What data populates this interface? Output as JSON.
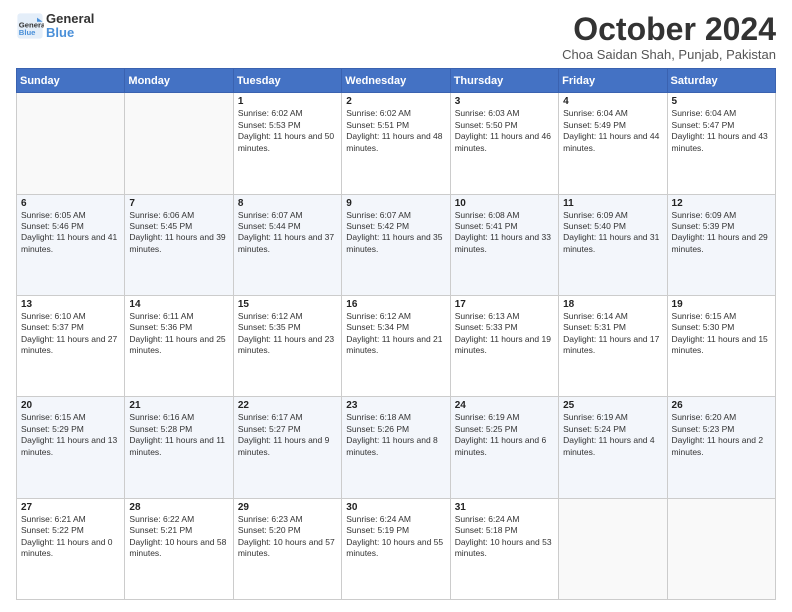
{
  "header": {
    "logo_line1": "General",
    "logo_line2": "Blue",
    "month": "October 2024",
    "location": "Choa Saidan Shah, Punjab, Pakistan"
  },
  "days_of_week": [
    "Sunday",
    "Monday",
    "Tuesday",
    "Wednesday",
    "Thursday",
    "Friday",
    "Saturday"
  ],
  "weeks": [
    [
      {
        "day": "",
        "sunrise": "",
        "sunset": "",
        "daylight": ""
      },
      {
        "day": "",
        "sunrise": "",
        "sunset": "",
        "daylight": ""
      },
      {
        "day": "1",
        "sunrise": "Sunrise: 6:02 AM",
        "sunset": "Sunset: 5:53 PM",
        "daylight": "Daylight: 11 hours and 50 minutes."
      },
      {
        "day": "2",
        "sunrise": "Sunrise: 6:02 AM",
        "sunset": "Sunset: 5:51 PM",
        "daylight": "Daylight: 11 hours and 48 minutes."
      },
      {
        "day": "3",
        "sunrise": "Sunrise: 6:03 AM",
        "sunset": "Sunset: 5:50 PM",
        "daylight": "Daylight: 11 hours and 46 minutes."
      },
      {
        "day": "4",
        "sunrise": "Sunrise: 6:04 AM",
        "sunset": "Sunset: 5:49 PM",
        "daylight": "Daylight: 11 hours and 44 minutes."
      },
      {
        "day": "5",
        "sunrise": "Sunrise: 6:04 AM",
        "sunset": "Sunset: 5:47 PM",
        "daylight": "Daylight: 11 hours and 43 minutes."
      }
    ],
    [
      {
        "day": "6",
        "sunrise": "Sunrise: 6:05 AM",
        "sunset": "Sunset: 5:46 PM",
        "daylight": "Daylight: 11 hours and 41 minutes."
      },
      {
        "day": "7",
        "sunrise": "Sunrise: 6:06 AM",
        "sunset": "Sunset: 5:45 PM",
        "daylight": "Daylight: 11 hours and 39 minutes."
      },
      {
        "day": "8",
        "sunrise": "Sunrise: 6:07 AM",
        "sunset": "Sunset: 5:44 PM",
        "daylight": "Daylight: 11 hours and 37 minutes."
      },
      {
        "day": "9",
        "sunrise": "Sunrise: 6:07 AM",
        "sunset": "Sunset: 5:42 PM",
        "daylight": "Daylight: 11 hours and 35 minutes."
      },
      {
        "day": "10",
        "sunrise": "Sunrise: 6:08 AM",
        "sunset": "Sunset: 5:41 PM",
        "daylight": "Daylight: 11 hours and 33 minutes."
      },
      {
        "day": "11",
        "sunrise": "Sunrise: 6:09 AM",
        "sunset": "Sunset: 5:40 PM",
        "daylight": "Daylight: 11 hours and 31 minutes."
      },
      {
        "day": "12",
        "sunrise": "Sunrise: 6:09 AM",
        "sunset": "Sunset: 5:39 PM",
        "daylight": "Daylight: 11 hours and 29 minutes."
      }
    ],
    [
      {
        "day": "13",
        "sunrise": "Sunrise: 6:10 AM",
        "sunset": "Sunset: 5:37 PM",
        "daylight": "Daylight: 11 hours and 27 minutes."
      },
      {
        "day": "14",
        "sunrise": "Sunrise: 6:11 AM",
        "sunset": "Sunset: 5:36 PM",
        "daylight": "Daylight: 11 hours and 25 minutes."
      },
      {
        "day": "15",
        "sunrise": "Sunrise: 6:12 AM",
        "sunset": "Sunset: 5:35 PM",
        "daylight": "Daylight: 11 hours and 23 minutes."
      },
      {
        "day": "16",
        "sunrise": "Sunrise: 6:12 AM",
        "sunset": "Sunset: 5:34 PM",
        "daylight": "Daylight: 11 hours and 21 minutes."
      },
      {
        "day": "17",
        "sunrise": "Sunrise: 6:13 AM",
        "sunset": "Sunset: 5:33 PM",
        "daylight": "Daylight: 11 hours and 19 minutes."
      },
      {
        "day": "18",
        "sunrise": "Sunrise: 6:14 AM",
        "sunset": "Sunset: 5:31 PM",
        "daylight": "Daylight: 11 hours and 17 minutes."
      },
      {
        "day": "19",
        "sunrise": "Sunrise: 6:15 AM",
        "sunset": "Sunset: 5:30 PM",
        "daylight": "Daylight: 11 hours and 15 minutes."
      }
    ],
    [
      {
        "day": "20",
        "sunrise": "Sunrise: 6:15 AM",
        "sunset": "Sunset: 5:29 PM",
        "daylight": "Daylight: 11 hours and 13 minutes."
      },
      {
        "day": "21",
        "sunrise": "Sunrise: 6:16 AM",
        "sunset": "Sunset: 5:28 PM",
        "daylight": "Daylight: 11 hours and 11 minutes."
      },
      {
        "day": "22",
        "sunrise": "Sunrise: 6:17 AM",
        "sunset": "Sunset: 5:27 PM",
        "daylight": "Daylight: 11 hours and 9 minutes."
      },
      {
        "day": "23",
        "sunrise": "Sunrise: 6:18 AM",
        "sunset": "Sunset: 5:26 PM",
        "daylight": "Daylight: 11 hours and 8 minutes."
      },
      {
        "day": "24",
        "sunrise": "Sunrise: 6:19 AM",
        "sunset": "Sunset: 5:25 PM",
        "daylight": "Daylight: 11 hours and 6 minutes."
      },
      {
        "day": "25",
        "sunrise": "Sunrise: 6:19 AM",
        "sunset": "Sunset: 5:24 PM",
        "daylight": "Daylight: 11 hours and 4 minutes."
      },
      {
        "day": "26",
        "sunrise": "Sunrise: 6:20 AM",
        "sunset": "Sunset: 5:23 PM",
        "daylight": "Daylight: 11 hours and 2 minutes."
      }
    ],
    [
      {
        "day": "27",
        "sunrise": "Sunrise: 6:21 AM",
        "sunset": "Sunset: 5:22 PM",
        "daylight": "Daylight: 11 hours and 0 minutes."
      },
      {
        "day": "28",
        "sunrise": "Sunrise: 6:22 AM",
        "sunset": "Sunset: 5:21 PM",
        "daylight": "Daylight: 10 hours and 58 minutes."
      },
      {
        "day": "29",
        "sunrise": "Sunrise: 6:23 AM",
        "sunset": "Sunset: 5:20 PM",
        "daylight": "Daylight: 10 hours and 57 minutes."
      },
      {
        "day": "30",
        "sunrise": "Sunrise: 6:24 AM",
        "sunset": "Sunset: 5:19 PM",
        "daylight": "Daylight: 10 hours and 55 minutes."
      },
      {
        "day": "31",
        "sunrise": "Sunrise: 6:24 AM",
        "sunset": "Sunset: 5:18 PM",
        "daylight": "Daylight: 10 hours and 53 minutes."
      },
      {
        "day": "",
        "sunrise": "",
        "sunset": "",
        "daylight": ""
      },
      {
        "day": "",
        "sunrise": "",
        "sunset": "",
        "daylight": ""
      }
    ]
  ]
}
